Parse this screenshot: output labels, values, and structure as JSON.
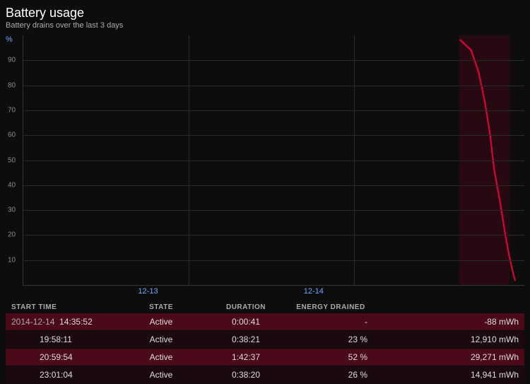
{
  "header": {
    "title": "Battery usage",
    "subtitle": "Battery drains over the last 3 days"
  },
  "chart": {
    "y_axis_label": "%",
    "y_ticks": [
      {
        "value": 90,
        "pct": 10
      },
      {
        "value": 80,
        "pct": 20
      },
      {
        "value": 70,
        "pct": 30
      },
      {
        "value": 60,
        "pct": 40
      },
      {
        "value": 50,
        "pct": 50
      },
      {
        "value": 40,
        "pct": 60
      },
      {
        "value": 30,
        "pct": 70
      },
      {
        "value": 20,
        "pct": 80
      },
      {
        "value": 10,
        "pct": 90
      }
    ],
    "x_labels": [
      {
        "label": "12-13",
        "pct": 25
      },
      {
        "label": "12-14",
        "pct": 58
      }
    ]
  },
  "table": {
    "columns": [
      "START TIME",
      "STATE",
      "DURATION",
      "ENERGY DRAINED",
      ""
    ],
    "rows": [
      {
        "start_time": "2014-12-14",
        "start_time2": "14:35:52",
        "state": "Active",
        "duration": "0:00:41",
        "energy_pct": "-",
        "energy_mwh": "-88 mWh",
        "highlighted": true
      },
      {
        "start_time": "",
        "start_time2": "19:58:11",
        "state": "Active",
        "duration": "0:38:21",
        "energy_pct": "23 %",
        "energy_mwh": "12,910 mWh",
        "highlighted": false
      },
      {
        "start_time": "",
        "start_time2": "20:59:54",
        "state": "Active",
        "duration": "1:42:37",
        "energy_pct": "52 %",
        "energy_mwh": "29,271 mWh",
        "highlighted": true
      },
      {
        "start_time": "",
        "start_time2": "23:01:04",
        "state": "Active",
        "duration": "0:38:20",
        "energy_pct": "26 %",
        "energy_mwh": "14,941 mWh",
        "highlighted": false
      }
    ]
  }
}
